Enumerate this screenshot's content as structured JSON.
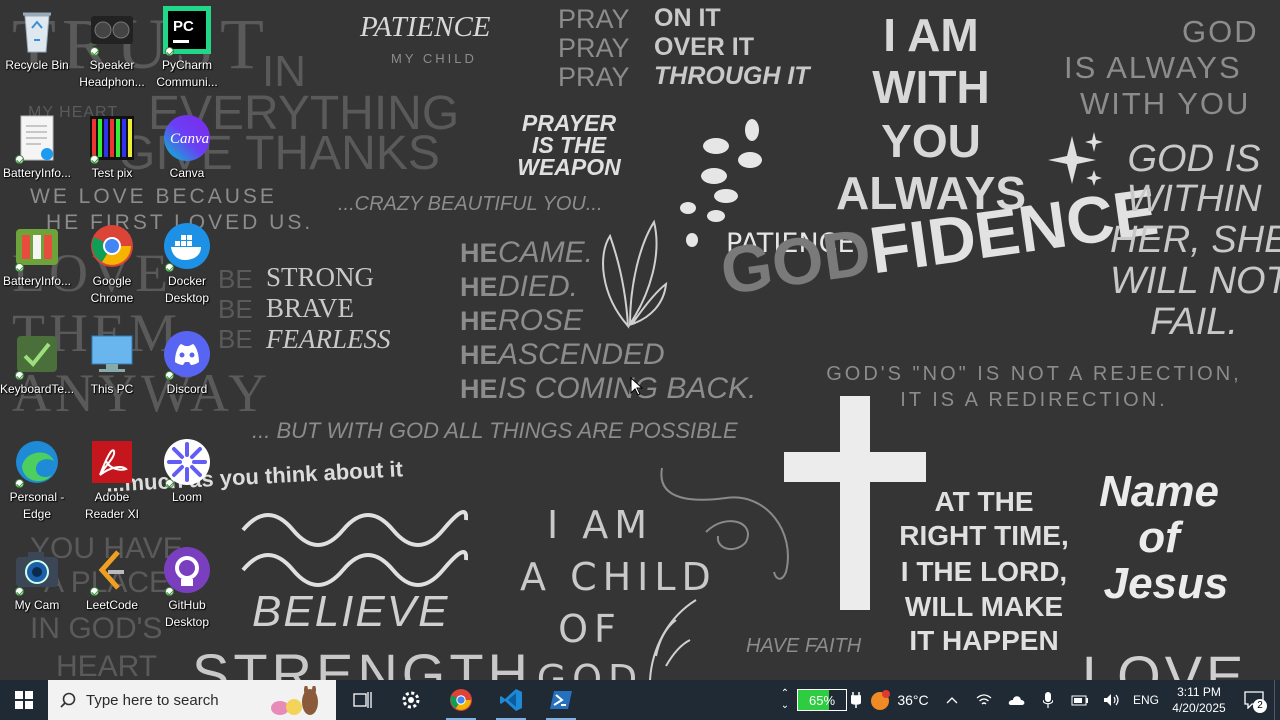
{
  "wallpaper": {
    "trust": "TRUST",
    "in": "IN",
    "everything": "EVERYTHING",
    "give_thanks": "GIVE THANKS",
    "my_heart": "MY HEART",
    "we_love": "WE LOVE BECAUSE",
    "he_first": "HE FIRST LOVED US.",
    "love": "LOVE",
    "them": "THEM",
    "anyway": "ANYWAY",
    "be": "BE",
    "strong": "STRONG",
    "brave": "BRAVE",
    "fearless": "FEARLESS",
    "you_have": "YOU HAVE",
    "a_place": "A PLACE",
    "in_gods": "IN GOD'S",
    "heart": "HEART",
    "patience_top": "PATIENCE",
    "my_child": "MY CHILD",
    "pray1": "PRAY",
    "on_it": "ON IT",
    "pray2": "PRAY",
    "over_it": "OVER IT",
    "pray3": "PRAY",
    "through_it": "THROUGH IT",
    "prayer_weapon_1": "PRAYER",
    "prayer_weapon_2": "IS THE",
    "prayer_weapon_3": "WEAPON",
    "crazy_beautiful": "...CRAZY BEAUTIFUL YOU...",
    "he": "HE",
    "came": "CAME.",
    "died": "DIED.",
    "rose": "ROSE",
    "ascended": "ASCENDED",
    "coming_back": "IS COMING BACK.",
    "but_with_god": "... BUT WITH GOD ALL THINGS ARE POSSIBLE",
    "think_about": "...much as you think about it",
    "believe": "BELIEVE",
    "strength": "STRENGTH",
    "i_am_child_1": "I AM",
    "i_am_child_2": "A CHILD",
    "i_am_child_3": "OF",
    "i_am_child_4": "GOD",
    "i_am_with_you_1": "I AM",
    "i_am_with_you_2": "WITH",
    "i_am_with_you_3": "YOU",
    "i_am_with_you_4": "ALWAYS",
    "patience_mid": "PATIENCE",
    "godfidence_god": "GOD",
    "godfidence_fidence": "FIDENCE",
    "gods_no_1": "GOD'S \"NO\" IS NOT A REJECTION,",
    "gods_no_2": "IT IS A REDIRECTION.",
    "god_always_1": "GOD",
    "god_always_2": "IS ALWAYS",
    "god_always_3": "WITH YOU",
    "god_within_1": "GOD IS",
    "god_within_2": "WITHIN",
    "god_within_3": "HER, SHE",
    "god_within_4": "WILL NOT",
    "god_within_5": "FAIL.",
    "right_time_1": "AT THE",
    "right_time_2": "RIGHT TIME,",
    "right_time_3": "I THE LORD,",
    "right_time_4": "WILL MAKE",
    "right_time_5": "IT HAPPEN",
    "have_faith": "HAVE FAITH",
    "name_of_jesus_1": "Name",
    "name_of_jesus_2": "of",
    "name_of_jesus_3": "Jesus",
    "love_bottom": "LOVE"
  },
  "desktop_icons": [
    {
      "label": "Recycle Bin",
      "icon": "recycle-bin-icon"
    },
    {
      "label": "Speaker Headphon...",
      "icon": "speaker-headphones-icon"
    },
    {
      "label": "PyCharm Communi...",
      "icon": "pycharm-icon"
    },
    {
      "label": "BatteryInfo...",
      "icon": "document-icon"
    },
    {
      "label": "Test pix",
      "icon": "test-pix-icon"
    },
    {
      "label": "Canva",
      "icon": "canva-icon"
    },
    {
      "label": "BatteryInfo...",
      "icon": "battery-info-icon"
    },
    {
      "label": "Google Chrome",
      "icon": "chrome-icon"
    },
    {
      "label": "Docker Desktop",
      "icon": "docker-icon"
    },
    {
      "label": "KeyboardTe...",
      "icon": "keyboard-test-icon"
    },
    {
      "label": "This PC",
      "icon": "this-pc-icon"
    },
    {
      "label": "Discord",
      "icon": "discord-icon"
    },
    {
      "label": "Personal - Edge",
      "icon": "edge-icon"
    },
    {
      "label": "Adobe Reader XI",
      "icon": "adobe-reader-icon"
    },
    {
      "label": "Loom",
      "icon": "loom-icon"
    },
    {
      "label": "My Cam",
      "icon": "camera-icon"
    },
    {
      "label": "LeetCode",
      "icon": "leetcode-icon"
    },
    {
      "label": "GitHub Desktop",
      "icon": "github-icon"
    }
  ],
  "taskbar": {
    "search_placeholder": "Type here to search",
    "battery_percent": "65%",
    "weather": "36°C",
    "language": "ENG",
    "time": "3:11 PM",
    "date": "4/20/2025",
    "notification_count": "2"
  },
  "colors": {
    "taskbar": "#1f2a35",
    "battery_bar": "#2ecc40",
    "wallpaper": "#353535"
  }
}
